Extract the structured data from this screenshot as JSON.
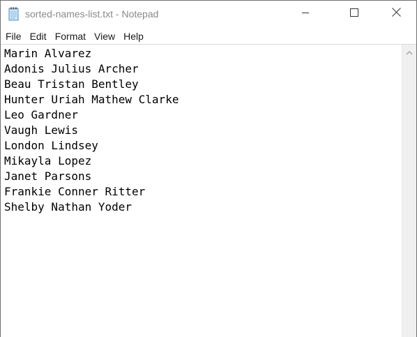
{
  "window": {
    "title": "sorted-names-list.txt - Notepad",
    "controls": {
      "minimize_icon": "minimize-icon",
      "maximize_icon": "maximize-icon",
      "close_icon": "close-icon"
    }
  },
  "menu": {
    "items": [
      "File",
      "Edit",
      "Format",
      "View",
      "Help"
    ]
  },
  "editor": {
    "lines": [
      "Marin Alvarez",
      "Adonis Julius Archer",
      "Beau Tristan Bentley",
      "Hunter Uriah Mathew Clarke",
      "Leo Gardner",
      "Vaugh Lewis",
      "London Lindsey",
      "Mikayla Lopez",
      "Janet Parsons",
      "Frankie Conner Ritter",
      "Shelby Nathan Yoder"
    ]
  },
  "scrollbar": {
    "up_icon": "chevron-up-icon"
  },
  "colors": {
    "title_text": "#8a8a8a",
    "menu_text": "#1a1a1a",
    "scrollbar_track": "#f0f0f0"
  }
}
